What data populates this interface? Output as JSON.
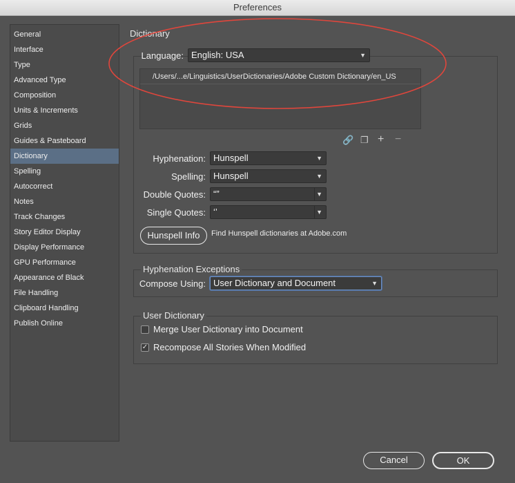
{
  "window": {
    "title": "Preferences"
  },
  "sidebar": {
    "items": [
      {
        "label": "General"
      },
      {
        "label": "Interface"
      },
      {
        "label": "Type"
      },
      {
        "label": "Advanced Type"
      },
      {
        "label": "Composition"
      },
      {
        "label": "Units & Increments"
      },
      {
        "label": "Grids"
      },
      {
        "label": "Guides & Pasteboard"
      },
      {
        "label": "Dictionary"
      },
      {
        "label": "Spelling"
      },
      {
        "label": "Autocorrect"
      },
      {
        "label": "Notes"
      },
      {
        "label": "Track Changes"
      },
      {
        "label": "Story Editor Display"
      },
      {
        "label": "Display Performance"
      },
      {
        "label": "GPU Performance"
      },
      {
        "label": "Appearance of Black"
      },
      {
        "label": "File Handling"
      },
      {
        "label": "Clipboard Handling"
      },
      {
        "label": "Publish Online"
      }
    ],
    "selected": "Dictionary"
  },
  "dictionary": {
    "title": "Dictionary",
    "language_label": "Language:",
    "language_value": "English: USA",
    "path": "/Users/...e/Linguistics/UserDictionaries/Adobe Custom Dictionary/en_US",
    "hyphenation_label": "Hyphenation:",
    "hyphenation_value": "Hunspell",
    "spelling_label": "Spelling:",
    "spelling_value": "Hunspell",
    "double_quotes_label": "Double Quotes:",
    "double_quotes_value": "“”",
    "single_quotes_label": "Single Quotes:",
    "single_quotes_value": "‘’",
    "hunspell_info_label": "Hunspell Info",
    "hunspell_hint": "Find Hunspell dictionaries at Adobe.com"
  },
  "hyphenation_exceptions": {
    "title": "Hyphenation Exceptions",
    "compose_label": "Compose Using:",
    "compose_value": "User Dictionary and Document"
  },
  "user_dictionary": {
    "title": "User Dictionary",
    "merge_label": "Merge User Dictionary into Document",
    "merge_checked": false,
    "recompose_label": "Recompose All Stories When Modified",
    "recompose_checked": true
  },
  "buttons": {
    "cancel": "Cancel",
    "ok": "OK"
  },
  "annotation": {
    "color": "#e0463c"
  }
}
